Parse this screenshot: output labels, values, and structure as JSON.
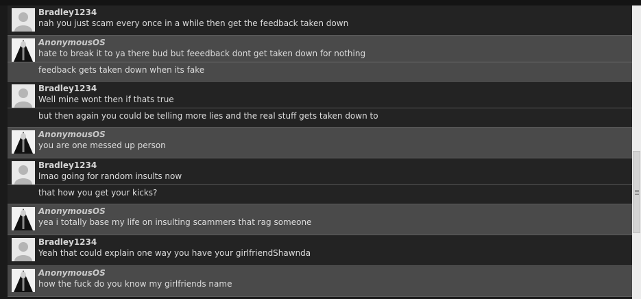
{
  "messages": [
    {
      "sender": "Bradley1234",
      "type": "b",
      "lines": [
        "nah you just scam every once in a while then get the feedback taken down"
      ]
    },
    {
      "sender": "AnonymousOS",
      "type": "a",
      "lines": [
        "hate to break it to ya there bud but feeedback dont get taken down for nothing",
        "feedback gets taken down when its fake"
      ]
    },
    {
      "sender": "Bradley1234",
      "type": "b",
      "lines": [
        "Well mine wont then if thats true",
        "but then again you could be telling more lies and the real stuff gets taken down to"
      ]
    },
    {
      "sender": "AnonymousOS",
      "type": "a",
      "lines": [
        "you are one messed up person"
      ]
    },
    {
      "sender": "Bradley1234",
      "type": "b",
      "lines": [
        "lmao going for random insults now",
        "that how you get your kicks?"
      ]
    },
    {
      "sender": "AnonymousOS",
      "type": "a",
      "lines": [
        "yea i totally base my life on insulting scammers that rag someone"
      ]
    },
    {
      "sender": "Bradley1234",
      "type": "b",
      "lines": [
        "Yeah that could explain one way you have your girlfriendShawnda"
      ]
    },
    {
      "sender": "AnonymousOS",
      "type": "a",
      "lines": [
        "how the fuck do you know my girlfriends name"
      ]
    }
  ],
  "avatars": {
    "b": "default-user-icon",
    "a": "anonymous-mask-icon"
  }
}
